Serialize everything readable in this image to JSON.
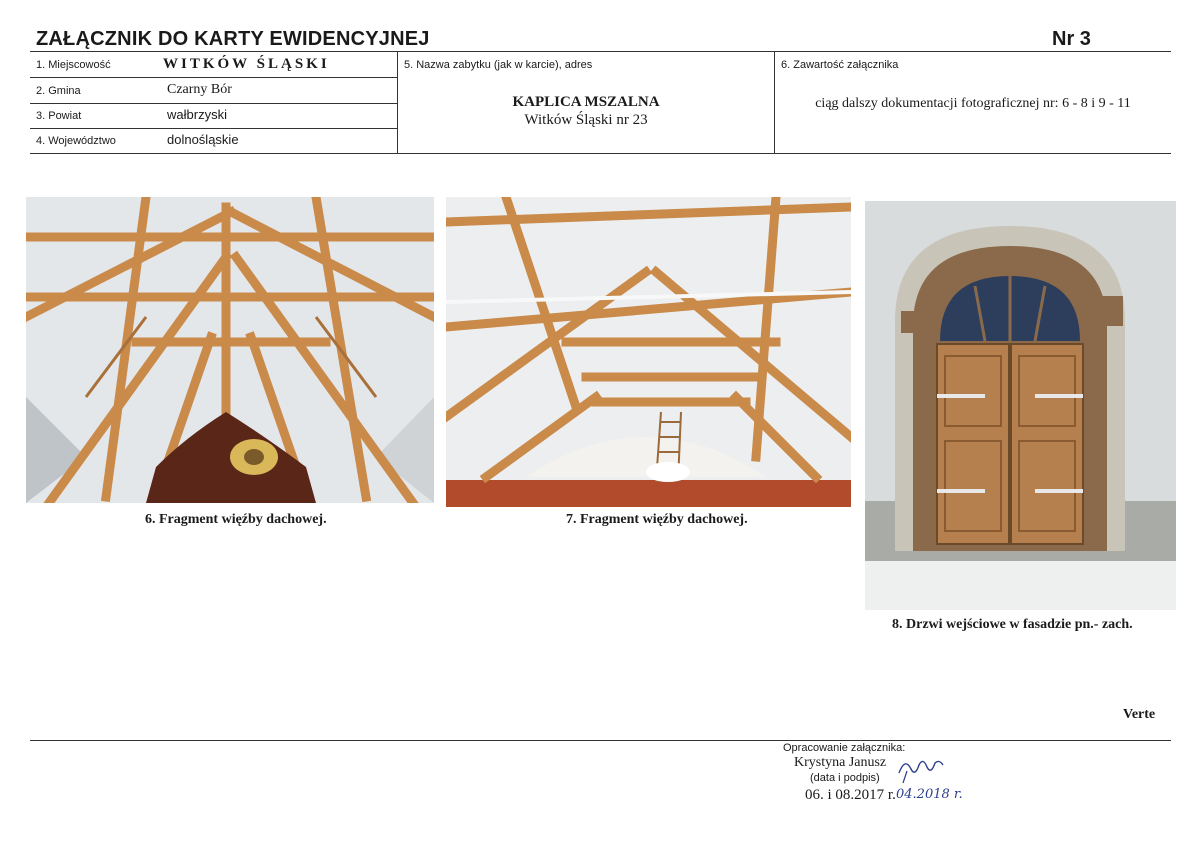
{
  "header": {
    "title": "ZAŁĄCZNIK DO KARTY EWIDENCYJNEJ",
    "number": "Nr 3"
  },
  "fields": [
    {
      "label": "1. Miejscowość",
      "value": "WITKÓW ŚLĄSKI"
    },
    {
      "label": "2. Gmina",
      "value": "Czarny Bór"
    },
    {
      "label": "3. Powiat",
      "value": "wałbrzyski"
    },
    {
      "label": "4. Województwo",
      "value": "dolnośląskie"
    }
  ],
  "monument": {
    "label": "5. Nazwa zabytku (jak w karcie), adres",
    "name": "KAPLICA MSZALNA",
    "address": "Witków Śląski nr 23"
  },
  "contents": {
    "label": "6. Zawartość załącznika",
    "text": "ciąg dalszy dokumentacji fotograficznej nr: 6 - 8 i 9 - 11"
  },
  "photos": [
    {
      "caption": "6. Fragment więźby dachowej."
    },
    {
      "caption": "7. Fragment więźby dachowej."
    },
    {
      "caption": "8. Drzwi wejściowe w fasadzie pn.- zach."
    }
  ],
  "verte": "Verte",
  "footer": {
    "prepared_label": "Opracowanie załącznika:",
    "author": "Krystyna Janusz",
    "sign_label": "(data i podpis)",
    "date": "06. i 08.2017 r.",
    "handwritten_date": "04.2018 r."
  }
}
